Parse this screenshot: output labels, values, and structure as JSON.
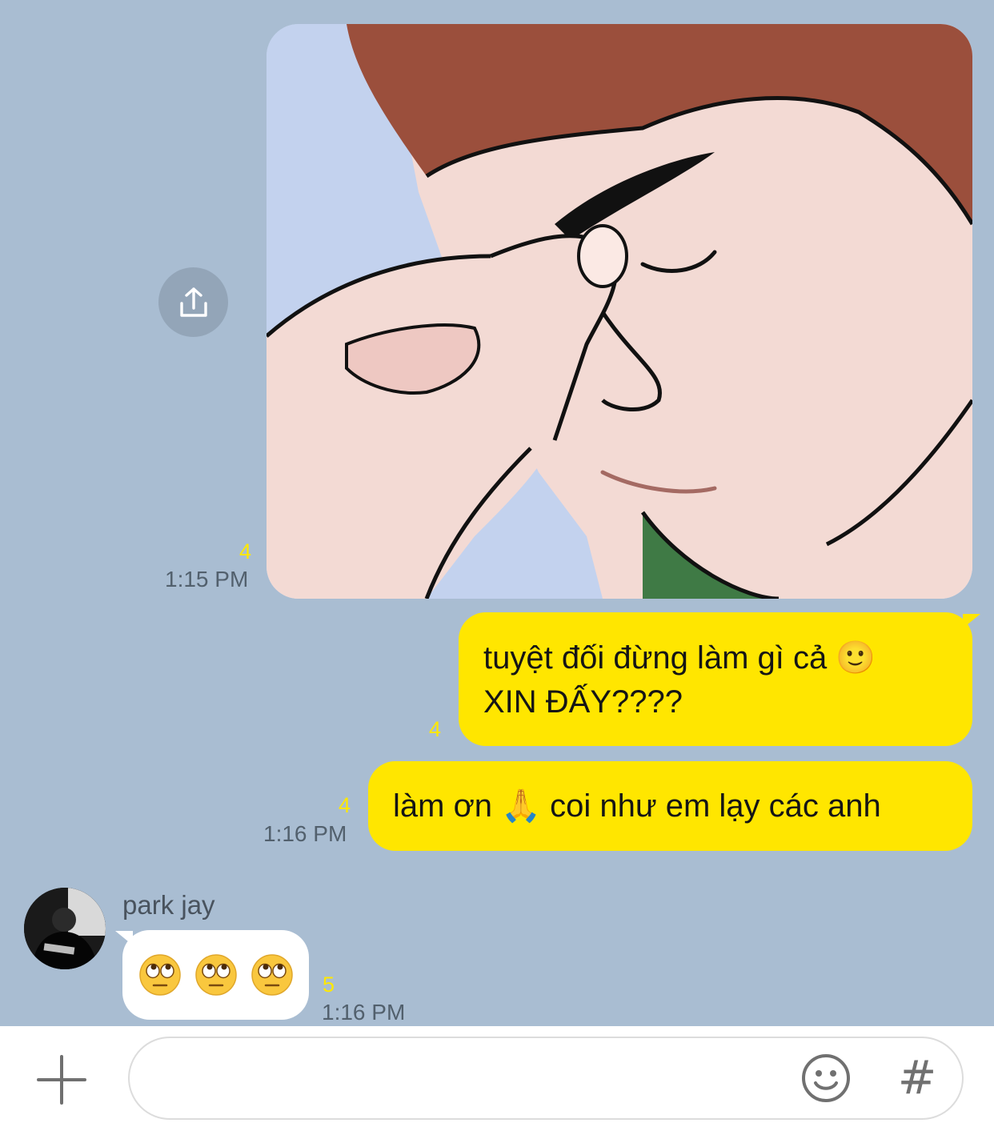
{
  "messages": {
    "image_msg": {
      "unread": "4",
      "time": "1:15 PM"
    },
    "text_msg_1": {
      "line1": "tuyệt đối đừng làm gì cả 🙂",
      "line2": "XIN ĐẤY????",
      "unread": "4"
    },
    "text_msg_2": {
      "text": "làm ơn 🙏 coi như em lạy các anh",
      "unread": "4",
      "time": "1:16 PM"
    },
    "reply_msg": {
      "sender": "park jay",
      "emoji_count": 3,
      "emoji": "eye-roll-face",
      "unread": "5",
      "time": "1:16 PM"
    }
  },
  "input_bar": {
    "placeholder": "",
    "hash_label": "#"
  },
  "icons": {
    "share": "share-icon",
    "plus": "plus-icon",
    "emoji": "smiley-icon",
    "hash": "hashtag-icon"
  },
  "colors": {
    "chat_bg": "#a9bdd2",
    "my_bubble": "#ffe600",
    "their_bubble": "#ffffff",
    "unread_count": "#ffe800"
  }
}
